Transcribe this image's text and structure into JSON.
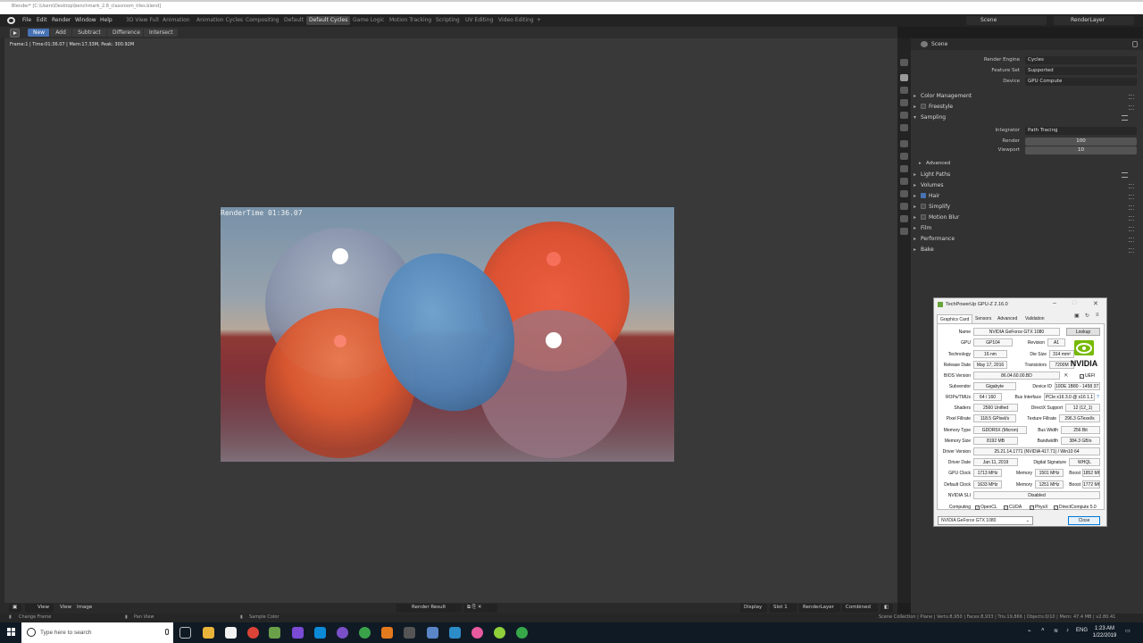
{
  "window": {
    "title": "Blender* [C:\\Users\\Desktop\\benchmark_2.8_classroom_tiles.blend]"
  },
  "menu": {
    "items": [
      "File",
      "Edit",
      "Render",
      "Window",
      "Help"
    ],
    "workspaces": [
      "3D View Full",
      "Animation",
      "Animation Cycles",
      "Compositing",
      "Default",
      "Default Cycles",
      "Game Logic",
      "Motion Tracking",
      "Scripting",
      "UV Editing",
      "Video Editing"
    ],
    "active_workspace": "Default Cycles",
    "add_tab": "+",
    "scene_field": "Scene",
    "layer_field": "RenderLayer"
  },
  "toolbar": {
    "buttons": [
      "New",
      "Add",
      "Subtract",
      "Difference",
      "Intersect"
    ],
    "active": "New"
  },
  "render_info": "Frame:1 | Time:01:36.07 | Mem:17.33M, Peak: 300.92M",
  "render_overlay": "RenderTime 01:36.07",
  "viewport_footer": {
    "view_menu": "View",
    "view": "View",
    "image": "Image",
    "image_name": "Render Result",
    "display": "Display",
    "slot": "Slot 1",
    "layer": "RenderLayer",
    "pass": "Combined"
  },
  "statusbar": {
    "left_items": [
      "Change Frame",
      "Pan View",
      "Sample Color"
    ],
    "stats": "Scene Collection | Plane | Verts:8,950 | Faces:8,933 | Tris:19,866 | Objects:0/10 | Mem: 47.4 MB | v2.80.41"
  },
  "properties": {
    "header": "Scene",
    "render_engine_label": "Render Engine",
    "render_engine": "Cycles",
    "feature_set_label": "Feature Set",
    "feature_set": "Supported",
    "device_label": "Device",
    "device": "GPU Compute",
    "sections": [
      {
        "label": "Color Management",
        "checkbox": null,
        "expanded": false
      },
      {
        "label": "Freestyle",
        "checkbox": false,
        "expanded": false
      },
      {
        "label": "Sampling",
        "checkbox": null,
        "expanded": true
      }
    ],
    "integrator_label": "Integrator",
    "integrator": "Path Tracing",
    "render_label": "Render",
    "render_samples": "100",
    "viewport_label": "Viewport",
    "viewport_samples": "10",
    "advanced": "Advanced",
    "sections2": [
      {
        "label": "Light Paths",
        "checkbox": null
      },
      {
        "label": "Volumes",
        "checkbox": null
      },
      {
        "label": "Hair",
        "checkbox": true
      },
      {
        "label": "Simplify",
        "checkbox": false
      },
      {
        "label": "Motion Blur",
        "checkbox": false
      },
      {
        "label": "Film",
        "checkbox": null
      },
      {
        "label": "Performance",
        "checkbox": null
      },
      {
        "label": "Bake",
        "checkbox": null
      }
    ]
  },
  "gpuz": {
    "title": "TechPowerUp GPU-Z 2.16.0",
    "tabs": [
      "Graphics Card",
      "Sensors",
      "Advanced",
      "Validation"
    ],
    "name_label": "Name",
    "name": "NVIDIA GeForce GTX 1080",
    "lookup": "Lookup",
    "gpu_label": "GPU",
    "gpu": "GP104",
    "revision_label": "Revision",
    "revision": "A1",
    "technology_label": "Technology",
    "technology": "16 nm",
    "die_size_label": "Die Size",
    "die_size": "314 mm²",
    "release_label": "Release Date",
    "release": "May 17, 2016",
    "transistors_label": "Transistors",
    "transistors": "7200M",
    "bios_label": "BIOS Version",
    "bios": "86.04.60.00.BD",
    "uefi": "UEFI",
    "subvendor_label": "Subvendor",
    "subvendor": "Gigabyte",
    "device_id_label": "Device ID",
    "device_id": "10DE 1B80 - 1458 3717",
    "rops_label": "ROPs/TMUs",
    "rops": "64 / 160",
    "bus_label": "Bus Interface",
    "bus": "PCIe x16 3.0 @ x16 1.1",
    "bus_help": "?",
    "shaders_label": "Shaders",
    "shaders": "2560 Unified",
    "dx_label": "DirectX Support",
    "dx": "12 (12_1)",
    "pixel_label": "Pixel Fillrate",
    "pixel": "118.5 GPixel/s",
    "texture_label": "Texture Fillrate",
    "texture": "296.3 GTexel/s",
    "memtype_label": "Memory Type",
    "memtype": "GDDR5X (Micron)",
    "buswidth_label": "Bus Width",
    "buswidth": "256 Bit",
    "memsize_label": "Memory Size",
    "memsize": "8192 MB",
    "bandwidth_label": "Bandwidth",
    "bandwidth": "384.3 GB/s",
    "driver_label": "Driver Version",
    "driver": "25.21.14.1771 (NVIDIA 417.71) / Win10 64",
    "driver_date_label": "Driver Date",
    "driver_date": "Jan 11, 2019",
    "sig_label": "Digital Signature",
    "sig": "WHQL",
    "gpu_clock_label": "GPU Clock",
    "gpu_clock": "1713 MHz",
    "mem_label": "Memory",
    "mem_clock": "1501 MHz",
    "boost_label": "Boost",
    "boost": "1852 MHz",
    "def_clock_label": "Default Clock",
    "def_clock": "1633 MHz",
    "def_mem": "1251 MHz",
    "def_boost": "1772 MHz",
    "sli_label": "NVIDIA SLI",
    "sli": "Disabled",
    "computing_label": "Computing",
    "computing": [
      "OpenCL",
      "CUDA",
      "PhysX",
      "DirectCompute 5.0"
    ],
    "brand": "NVIDIA",
    "select": "NVIDIA GeForce GTX 1080",
    "close": "Close"
  },
  "taskbar": {
    "search_placeholder": "Type here to search",
    "lang": "ENG",
    "time": "1:23 AM",
    "date": "1/22/2019"
  }
}
